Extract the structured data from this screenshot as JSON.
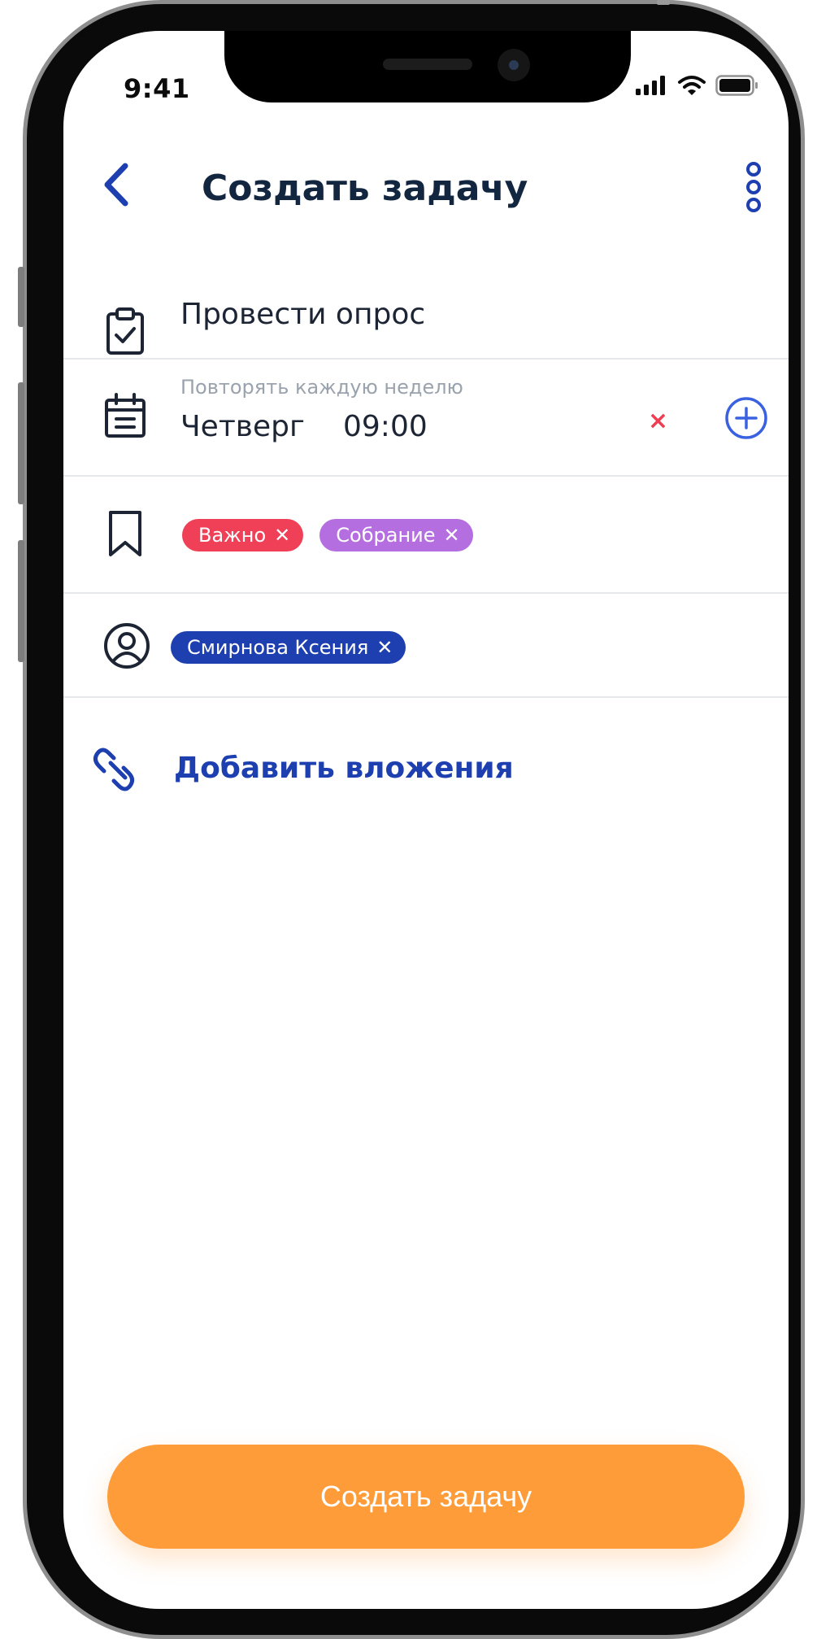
{
  "status_bar": {
    "time": "9:41"
  },
  "header": {
    "title": "Создать задачу"
  },
  "task": {
    "name": "Провести опрос"
  },
  "schedule": {
    "repeat_label": "Повторять каждую неделю",
    "day": "Четверг",
    "time": "09:00",
    "remove_label": "×"
  },
  "tags": [
    {
      "label": "Важно",
      "remove": "✕",
      "color": "#ef4057"
    },
    {
      "label": "Собрание",
      "remove": "✕",
      "color": "#b56ee0"
    }
  ],
  "assignees": [
    {
      "label": "Смирнова Ксения",
      "remove": "✕",
      "color": "#1d3fb0"
    }
  ],
  "attachments": {
    "label": "Добавить вложения"
  },
  "cta": {
    "label": "Создать задачу"
  },
  "colors": {
    "accent": "#1d3fb0",
    "cta": "#ff9c3a",
    "danger": "#ef3d52"
  }
}
